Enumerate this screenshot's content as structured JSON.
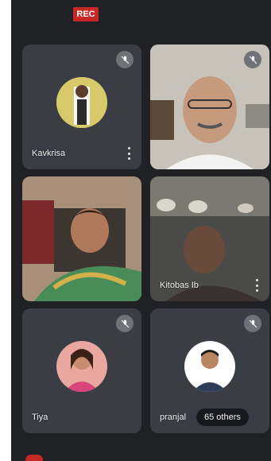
{
  "recording": {
    "label": "REC"
  },
  "participants": [
    {
      "name": "Kavkrisa",
      "type": "avatar",
      "muted": true,
      "avatar_bg": "#c9b35a",
      "more_icon": "more-vert-icon"
    },
    {
      "name": "",
      "type": "video",
      "muted": true,
      "scene": "man-glasses-office"
    },
    {
      "name": "",
      "type": "video",
      "muted": false,
      "scene": "woman-speaking-green-saree"
    },
    {
      "name": "Kitobas Ib",
      "type": "video",
      "muted": false,
      "scene": "man-dim-room",
      "more_icon": "more-vert-icon"
    },
    {
      "name": "Tiya",
      "type": "avatar",
      "muted": true,
      "avatar_bg": "#d85f7c"
    },
    {
      "name": "pranjal",
      "type": "avatar",
      "muted": true,
      "avatar_bg": "#ffffff"
    }
  ],
  "others_badge": {
    "label": "65 others"
  },
  "colors": {
    "background": "#1f2124",
    "tile": "#3a3d43",
    "rec": "#c62828"
  }
}
